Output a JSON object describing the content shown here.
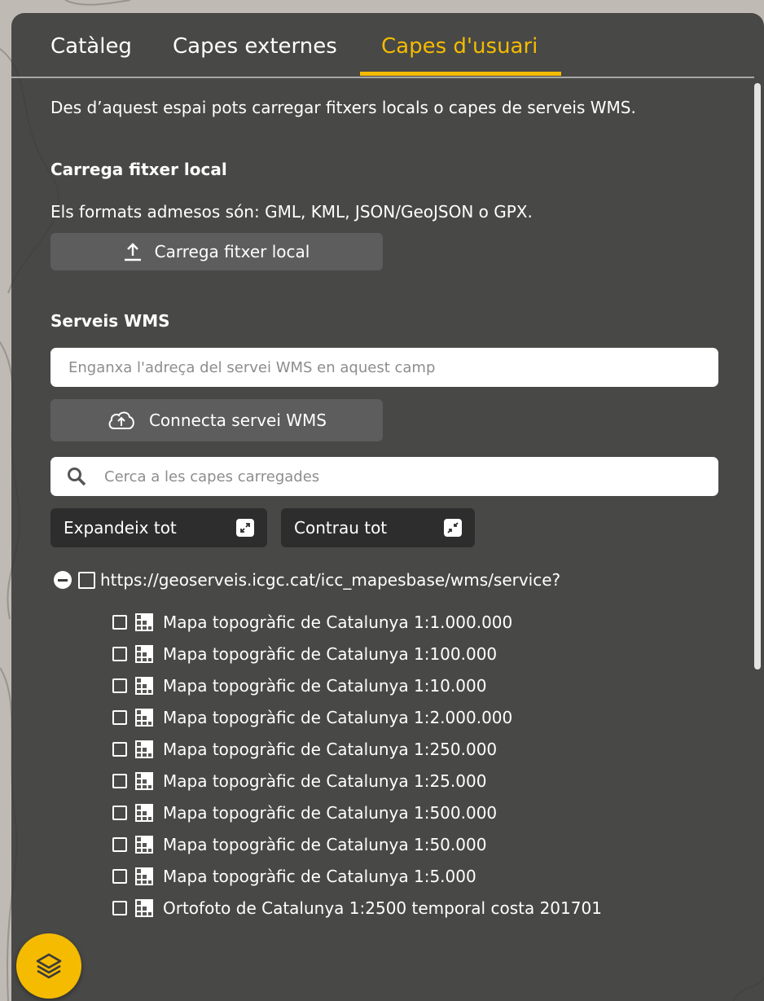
{
  "tabs": [
    {
      "label": "Catàleg",
      "active": false
    },
    {
      "label": "Capes externes",
      "active": false
    },
    {
      "label": "Capes d'usuari",
      "active": true
    }
  ],
  "description": "Des d’aquest espai pots carregar fitxers locals o capes de serveis WMS.",
  "local_file": {
    "heading": "Carrega fitxer local",
    "formats_text": "Els formats admesos són: GML, KML, JSON/GeoJSON o GPX.",
    "upload_button": "Carrega fitxer local"
  },
  "wms": {
    "heading": "Serveis WMS",
    "url_placeholder": "Enganxa l'adreça del servei WMS en aquest camp",
    "connect_button": "Connecta servei WMS"
  },
  "search": {
    "placeholder": "Cerca a les capes carregades"
  },
  "tree_controls": {
    "expand_label": "Expandeix tot",
    "collapse_label": "Contrau tot"
  },
  "service": {
    "url": "https://geoserveis.icgc.cat/icc_mapesbase/wms/service?",
    "layers": [
      "Mapa topogràfic de Catalunya 1:1.000.000",
      "Mapa topogràfic de Catalunya 1:100.000",
      "Mapa topogràfic de Catalunya 1:10.000",
      "Mapa topogràfic de Catalunya 1:2.000.000",
      "Mapa topogràfic de Catalunya 1:250.000",
      "Mapa topogràfic de Catalunya 1:25.000",
      "Mapa topogràfic de Catalunya 1:500.000",
      "Mapa topogràfic de Catalunya 1:50.000",
      "Mapa topogràfic de Catalunya 1:5.000",
      "Ortofoto de Catalunya 1:2500 temporal costa 201701"
    ]
  },
  "colors": {
    "accent": "#f4bb00",
    "panel": "#383838",
    "button": "#5d5d5d",
    "dark_button": "#2d2d2d"
  },
  "icons": {
    "upload": "upload-icon",
    "cloud": "cloud-upload-icon",
    "search": "search-icon",
    "expand": "expand-icon",
    "collapse": "collapse-icon",
    "layer": "layer-grid-icon",
    "layers_fab": "layers-icon"
  }
}
